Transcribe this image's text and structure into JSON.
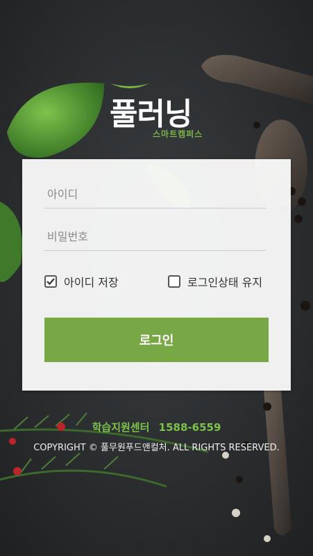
{
  "brand": {
    "logo_main": "풀러닝",
    "logo_sub": "스마트캠퍼스",
    "accent_color": "#78a845"
  },
  "login_form": {
    "id_placeholder": "아이디",
    "password_placeholder": "비밀번호",
    "save_id_label": "아이디 저장",
    "save_id_checked": true,
    "keep_login_label": "로그인상태 유지",
    "keep_login_checked": false,
    "login_button_label": "로그인"
  },
  "footer": {
    "support_label": "학습지원센터",
    "support_phone": "1588-6559",
    "copyright": "COPYRIGHT © 풀무원푸드앤컬처. ALL RIGHTS RESERVED."
  }
}
